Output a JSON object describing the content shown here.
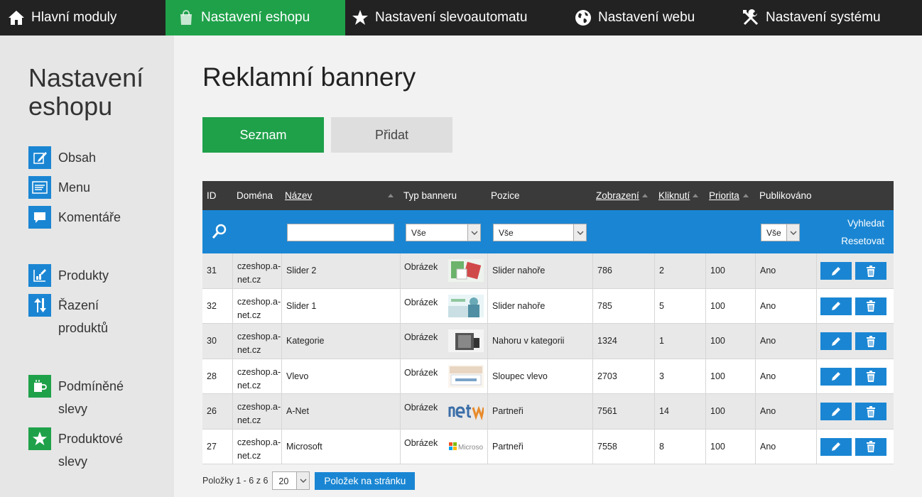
{
  "topnav": {
    "tabs": [
      {
        "label": "Hlavní moduly",
        "icon": "home-icon"
      },
      {
        "label": "Nastavení eshopu",
        "icon": "shopping-bag-icon"
      },
      {
        "label": "Nastavení slevoautomatu",
        "icon": "star-icon"
      },
      {
        "label": "Nastavení webu",
        "icon": "globe-icon"
      },
      {
        "label": "Nastavení systému",
        "icon": "tools-icon"
      }
    ],
    "active_index": 1
  },
  "sidebar": {
    "title": "Nastavení eshopu",
    "items": [
      {
        "label": "Obsah",
        "icon": "edit-content-icon"
      },
      {
        "label": "Menu",
        "icon": "menu-icon"
      },
      {
        "label": "Komentáře",
        "icon": "comment-icon"
      },
      {
        "label": "Produkty",
        "icon": "products-icon"
      },
      {
        "label": "Řazení produktů",
        "icon": "sort-arrows-icon"
      },
      {
        "label": "Podmíněné slevy",
        "icon": "conditional-discount-icon"
      },
      {
        "label": "Produktové slevy",
        "icon": "star-icon"
      }
    ]
  },
  "main": {
    "title": "Reklamní bannery",
    "tabs": {
      "list": "Seznam",
      "add": "Přidat"
    }
  },
  "table": {
    "headers": {
      "id": "ID",
      "domain": "Doména",
      "name": "Název",
      "type": "Typ banneru",
      "position": "Pozice",
      "views": "Zobrazení",
      "clicks": "Kliknutí",
      "priority": "Priorita",
      "published": "Publikováno"
    },
    "filters": {
      "name_value": "",
      "type_value": "Vše",
      "position_value": "Vše",
      "published_value": "Vše",
      "search_label": "Vyhledat",
      "reset_label": "Resetovat"
    },
    "rows": [
      {
        "id": "31",
        "domain": "czeshop.a-net.cz",
        "name": "Slider 2",
        "type": "Obrázek",
        "position": "Slider nahoře",
        "views": "786",
        "clicks": "2",
        "priority": "100",
        "published": "Ano"
      },
      {
        "id": "32",
        "domain": "czeshop.a-net.cz",
        "name": "Slider 1",
        "type": "Obrázek",
        "position": "Slider nahoře",
        "views": "785",
        "clicks": "5",
        "priority": "100",
        "published": "Ano"
      },
      {
        "id": "30",
        "domain": "czeshop.a-net.cz",
        "name": "Kategorie",
        "type": "Obrázek",
        "position": "Nahoru v kategorii",
        "views": "1324",
        "clicks": "1",
        "priority": "100",
        "published": "Ano"
      },
      {
        "id": "28",
        "domain": "czeshop.a-net.cz",
        "name": "Vlevo",
        "type": "Obrázek",
        "position": "Sloupec vlevo",
        "views": "2703",
        "clicks": "3",
        "priority": "100",
        "published": "Ano"
      },
      {
        "id": "26",
        "domain": "czeshop.a-net.cz",
        "name": "A-Net",
        "type": "Obrázek",
        "position": "Partneři",
        "views": "7561",
        "clicks": "14",
        "priority": "100",
        "published": "Ano"
      },
      {
        "id": "27",
        "domain": "czeshop.a-net.cz",
        "name": "Microsoft",
        "type": "Obrázek",
        "position": "Partneři",
        "views": "7558",
        "clicks": "8",
        "priority": "100",
        "published": "Ano"
      }
    ]
  },
  "pager": {
    "info": "Položky 1 - 6 z 6",
    "page_size": "20",
    "button_label": "Položek na stránku"
  },
  "colors": {
    "green": "#1fa14a",
    "blue": "#1a86d3",
    "dark": "#222222"
  }
}
